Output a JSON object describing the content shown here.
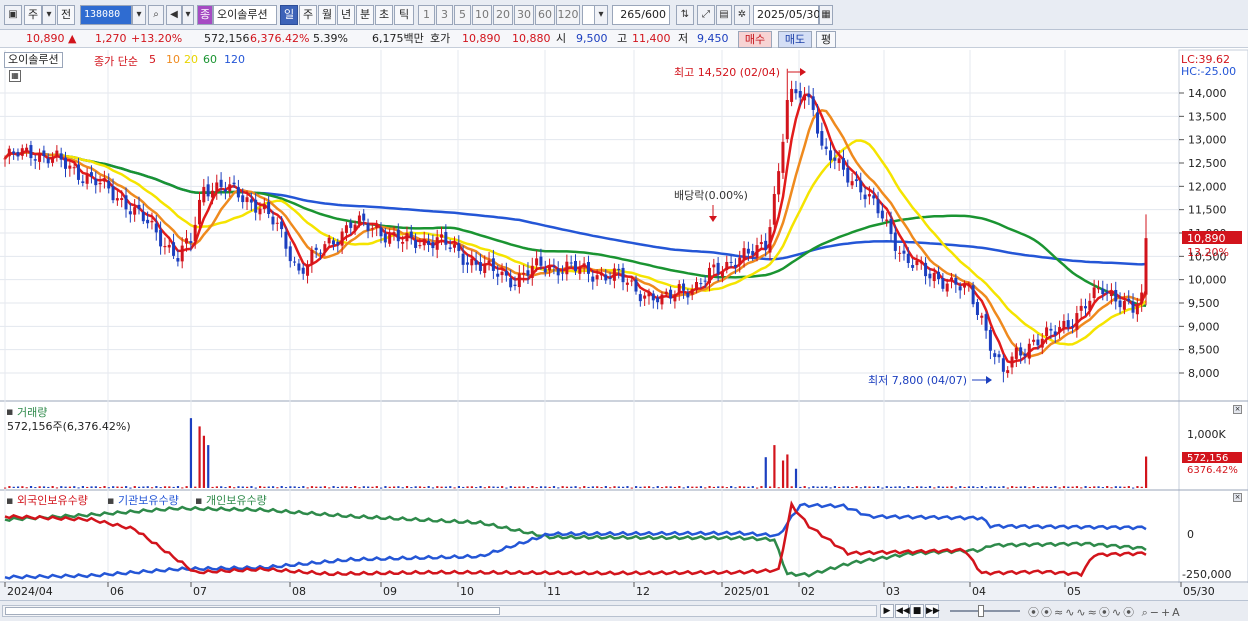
{
  "toolbar": {
    "period_tabs": [
      "주",
      "전",
      "일",
      "주",
      "월",
      "년",
      "분",
      "초",
      "틱"
    ],
    "stock_code": "138080",
    "stock_badge": "종",
    "stock_name": "오이솔루션",
    "minute_presets": [
      "1",
      "3",
      "5",
      "10",
      "20",
      "30",
      "60",
      "120"
    ],
    "bar_count": "265",
    "bar_total": "/600",
    "date": "2025/05/30"
  },
  "quote": {
    "price": "10,890",
    "change": "1,270",
    "change_pct": "+13.20%",
    "volume": "572,156",
    "volume_pct": "6,376.42%",
    "turnover_ratio": "5.39%",
    "amount": "6,175백만",
    "ask_label": "호가",
    "ask": "10,890",
    "bid": "10,880",
    "open_label": "시",
    "open": "9,500",
    "high_label": "고",
    "high": "11,400",
    "low_label": "저",
    "low": "9,450",
    "buy_label": "매수",
    "sell_label": "매도",
    "eval_label": "평"
  },
  "price_panel": {
    "title": "오이솔루션",
    "ma_label": "종가 단순",
    "ma_periods": [
      "5",
      "10",
      "20",
      "60",
      "120"
    ],
    "lc": "LC:39.62",
    "hc": "HC:-25.00",
    "last_price_tag": "10,890",
    "last_pct_tag": "13.20%",
    "high_annotation": "최고 14,520 (02/04)",
    "low_annotation": "최저 7,800 (04/07)",
    "dividend_annotation": "배당락(0.00%)",
    "y_ticks": [
      "14,000",
      "13,500",
      "13,000",
      "12,500",
      "12,000",
      "11,500",
      "11,000",
      "10,500",
      "10,000",
      "9,500",
      "9,000",
      "8,500",
      "8,000"
    ]
  },
  "volume_panel": {
    "title": "거래량",
    "value": "572,156주(6,376.42%)",
    "y_tick": "1,000K",
    "last_tag": "572,156",
    "last_pct_tag": "6376.42%"
  },
  "holdings_panel": {
    "legend": [
      "외국인보유수량",
      "기관보유수량",
      "개인보유수량"
    ],
    "y_ticks": [
      "0",
      "-250,000"
    ]
  },
  "x_axis": {
    "labels": [
      "2024/04",
      "06",
      "07",
      "08",
      "09",
      "10",
      "11",
      "12",
      "2025/01",
      "02",
      "03",
      "04",
      "05",
      "05/30"
    ]
  },
  "colors": {
    "up": "#d2141c",
    "down": "#1c3fbf",
    "ma5": "#e21b1b",
    "ma10": "#ef8a1e",
    "ma20": "#f5e400",
    "ma60": "#1a9431",
    "ma120": "#2456d6",
    "foreign": "#d2141c",
    "institution": "#2456d6",
    "individual": "#2e8a4a"
  },
  "chart_data": {
    "type": "candlestick",
    "x_range": [
      "2024/04",
      "2025/05/30"
    ],
    "price_ylim": [
      7500,
      14700
    ],
    "close_series": {
      "x": [
        "2024/04",
        "2024/05",
        "2024/06",
        "2024/07",
        "2024/08",
        "2024/09",
        "2024/10",
        "2024/11",
        "2024/12",
        "2025/01",
        "2025/02/04",
        "2025/03",
        "2025/04/07",
        "2025/05",
        "2025/05/30"
      ],
      "values": [
        12600,
        12300,
        11300,
        11900,
        10700,
        11000,
        10700,
        10100,
        9800,
        10600,
        14520,
        11500,
        7800,
        9700,
        10890
      ]
    },
    "volume_last": 572156,
    "volume_ylim": [
      0,
      1100000
    ]
  }
}
